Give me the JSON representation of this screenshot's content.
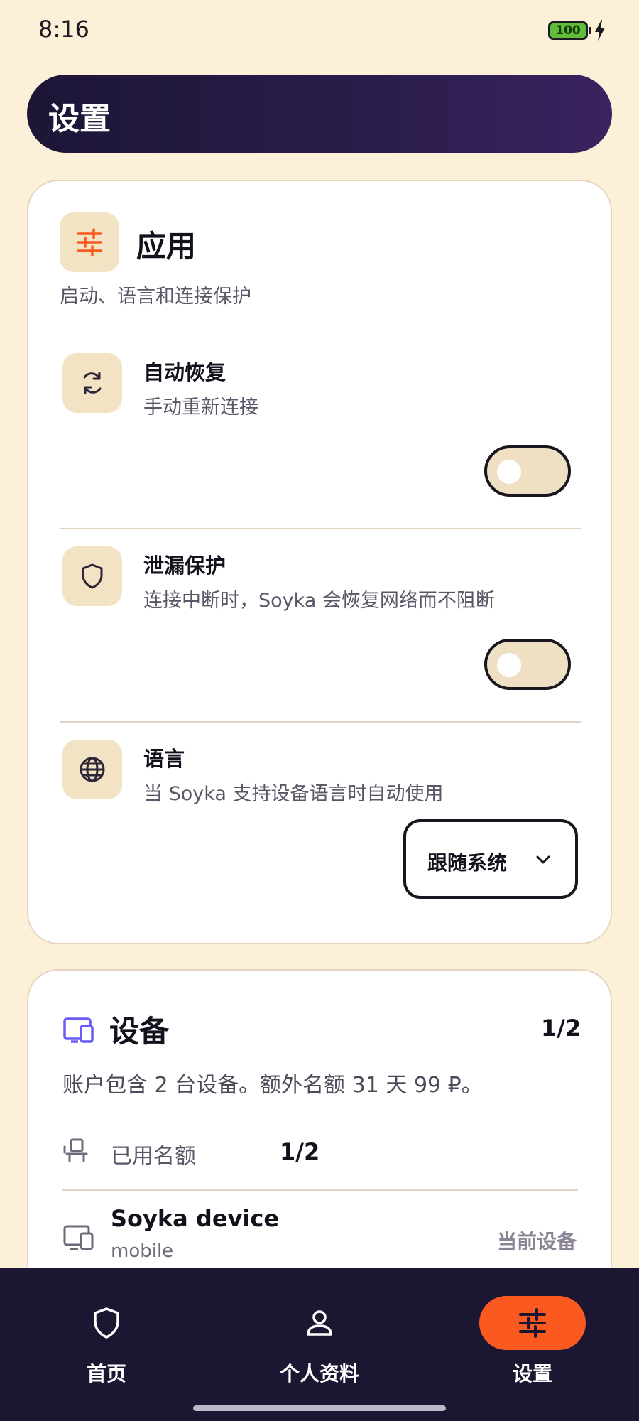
{
  "status_bar": {
    "time": "8:16",
    "battery": "100"
  },
  "header": {
    "title": "设置"
  },
  "app_section": {
    "title": "应用",
    "subtitle": "启动、语言和连接保护",
    "items": [
      {
        "title": "自动恢复",
        "desc": "手动重新连接",
        "toggle_on": false
      },
      {
        "title": "泄漏保护",
        "desc": "连接中断时，Soyka 会恢复网络而不阻断",
        "toggle_on": false
      },
      {
        "title": "语言",
        "desc": "当 Soyka 支持设备语言时自动使用",
        "select_value": "跟随系统"
      }
    ]
  },
  "devices_section": {
    "title": "设备",
    "count": "1/2",
    "desc": "账户包含 2 台设备。额外名额 31 天 99 ₽。",
    "used_label": "已用名额",
    "used_value": "1/2",
    "device": {
      "name": "Soyka device",
      "type": "mobile",
      "badge": "当前设备"
    }
  },
  "bottom_nav": {
    "items": [
      {
        "label": "首页",
        "icon": "shield-icon",
        "active": false
      },
      {
        "label": "个人资料",
        "icon": "person-icon",
        "active": false
      },
      {
        "label": "设置",
        "icon": "sliders-icon",
        "active": true
      }
    ]
  },
  "colors": {
    "accent": "#fa5a1f",
    "nav_bg": "#1b1632",
    "page_bg": "#fdf0d8",
    "icon_bg": "#f1e3c3",
    "device_accent": "#6a5af9"
  }
}
